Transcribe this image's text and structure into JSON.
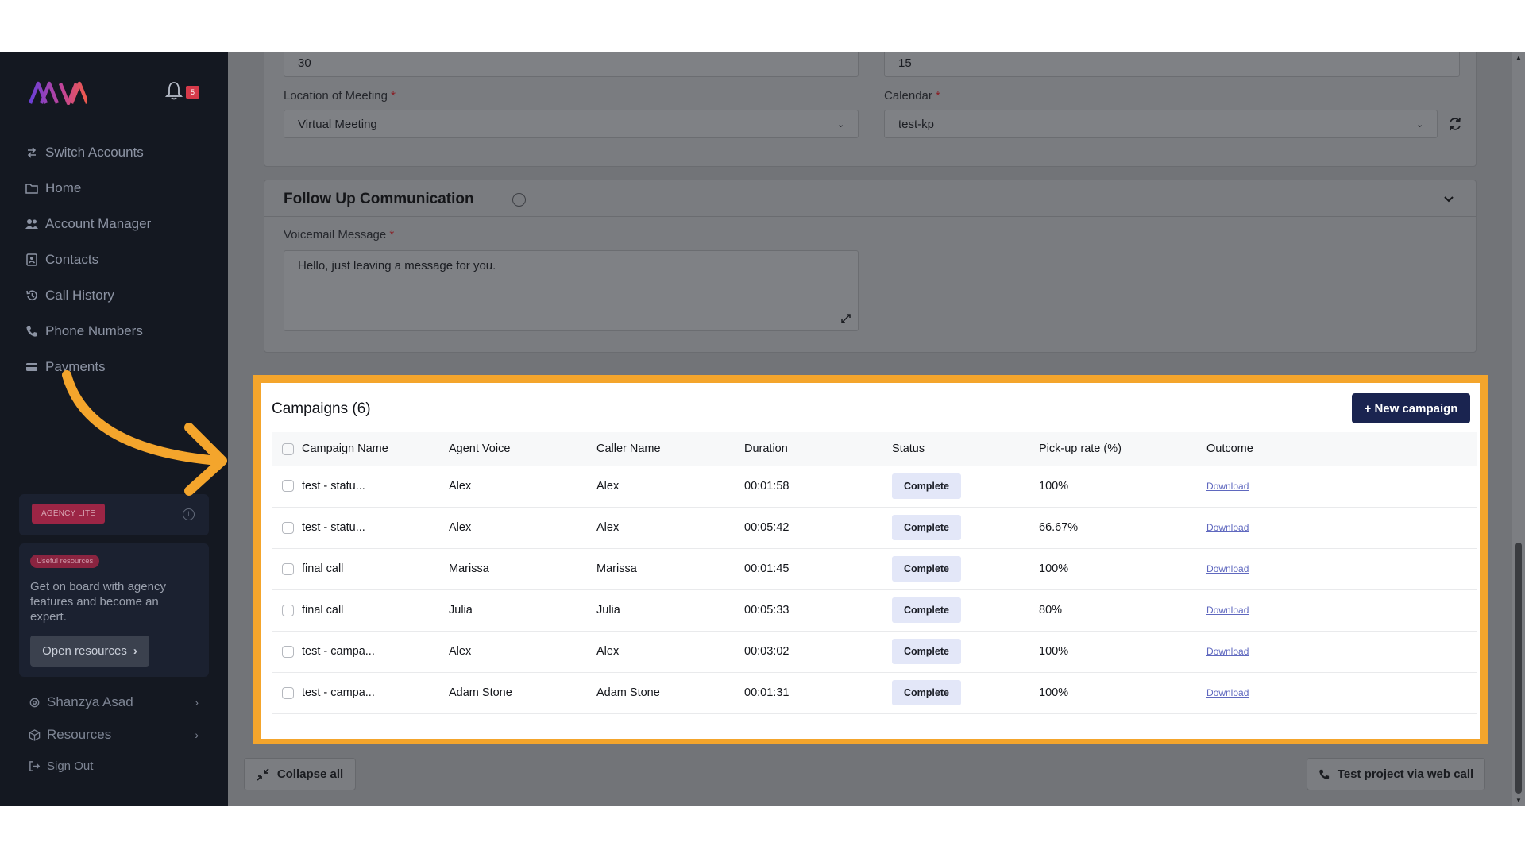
{
  "notifications": {
    "count": "5"
  },
  "sidebar": {
    "items": [
      {
        "label": "Switch Accounts",
        "icon": "switch-icon"
      },
      {
        "label": "Home",
        "icon": "folder-icon"
      },
      {
        "label": "Account Manager",
        "icon": "users-icon"
      },
      {
        "label": "Contacts",
        "icon": "contacts-icon"
      },
      {
        "label": "Call History",
        "icon": "history-icon"
      },
      {
        "label": "Phone Numbers",
        "icon": "phone-icon"
      },
      {
        "label": "Payments",
        "icon": "card-icon"
      }
    ],
    "plan_badge": "AGENCY LITE",
    "resources_card": {
      "badge": "Useful resources",
      "text": "Get on board with agency features and become an expert.",
      "button": "Open resources"
    },
    "user_name": "Shanzya Asad",
    "resources_label": "Resources",
    "sign_out": "Sign Out"
  },
  "form": {
    "field_top_left_value": "30",
    "field_top_right_value": "15",
    "location_label": "Location of Meeting",
    "location_value": "Virtual Meeting",
    "calendar_label": "Calendar",
    "calendar_value": "test-kp",
    "required_mark": "*"
  },
  "follow_up": {
    "title": "Follow Up Communication",
    "voicemail_label": "Voicemail Message",
    "voicemail_value": "Hello, just leaving a message for you."
  },
  "campaigns": {
    "title": "Campaigns (6)",
    "new_button": "+ New campaign",
    "columns": [
      "Campaign Name",
      "Agent Voice",
      "Caller Name",
      "Duration",
      "Status",
      "Pick-up rate (%)",
      "Outcome"
    ],
    "rows": [
      {
        "name": "test - statu...",
        "voice": "Alex",
        "caller": "Alex",
        "duration": "00:01:58",
        "status": "Complete",
        "rate": "100%",
        "outcome": "Download"
      },
      {
        "name": "test - statu...",
        "voice": "Alex",
        "caller": "Alex",
        "duration": "00:05:42",
        "status": "Complete",
        "rate": "66.67%",
        "outcome": "Download"
      },
      {
        "name": "final call",
        "voice": "Marissa",
        "caller": "Marissa",
        "duration": "00:01:45",
        "status": "Complete",
        "rate": "100%",
        "outcome": "Download"
      },
      {
        "name": "final call",
        "voice": "Julia",
        "caller": "Julia",
        "duration": "00:05:33",
        "status": "Complete",
        "rate": "80%",
        "outcome": "Download"
      },
      {
        "name": "test - campa...",
        "voice": "Alex",
        "caller": "Alex",
        "duration": "00:03:02",
        "status": "Complete",
        "rate": "100%",
        "outcome": "Download"
      },
      {
        "name": "test - campa...",
        "voice": "Adam Stone",
        "caller": "Adam Stone",
        "duration": "00:01:31",
        "status": "Complete",
        "rate": "100%",
        "outcome": "Download"
      }
    ]
  },
  "footer": {
    "collapse_label": "Collapse all",
    "test_label": "Test project via web call"
  },
  "colors": {
    "highlight": "#f4a52c",
    "primary_button": "#1a2450",
    "sidebar": "#141821"
  }
}
